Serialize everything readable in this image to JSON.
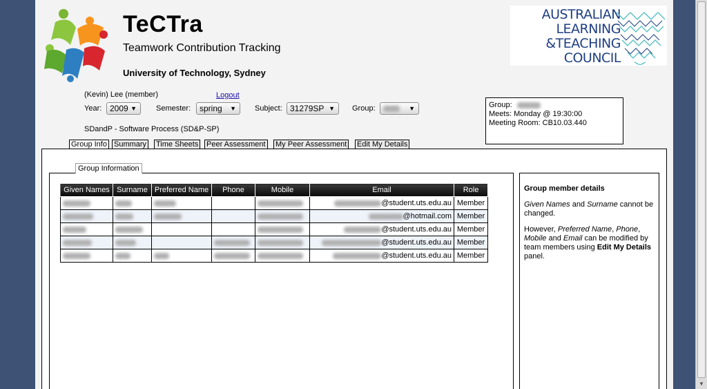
{
  "header": {
    "title": "TeCTra",
    "subtitle": "Teamwork Contribution Tracking",
    "university": "University of Technology, Sydney",
    "partner_logo_lines": [
      "AUSTRALIAN",
      "LEARNING",
      "&TEACHING",
      "COUNCIL"
    ]
  },
  "user": {
    "name": "(Kevin) Lee (member)",
    "logout_label": "Logout"
  },
  "selectors": {
    "year_label": "Year:",
    "year_value": "2009",
    "semester_label": "Semester:",
    "semester_value": "spring",
    "subject_label": "Subject:",
    "subject_value": "31279SP",
    "group_label": "Group:"
  },
  "subject_name": "SDandP - Software Process (SD&P-SP)",
  "group_box": {
    "group_label": "Group:",
    "meets": "Meets: Monday @ 19:30:00",
    "room": "Meeting Room: CB10.03.440"
  },
  "tabs": [
    {
      "label": "Group Info",
      "active": true
    },
    {
      "label": "Summary"
    },
    {
      "label": "Time Sheets"
    },
    {
      "label": "Peer Assessment"
    },
    {
      "label": "My Peer Assessment"
    },
    {
      "label": "Edit My Details"
    }
  ],
  "fieldset_legend": "Group Information",
  "table": {
    "columns": [
      "Given Names",
      "Surname",
      "Preferred Name",
      "Phone",
      "Mobile",
      "Email",
      "Role"
    ],
    "rows": [
      {
        "email": "@student.uts.edu.au",
        "role": "Member"
      },
      {
        "email": "@hotmail.com",
        "role": "Member"
      },
      {
        "email": "@student.uts.edu.au",
        "role": "Member"
      },
      {
        "email": "@student.uts.edu.au",
        "role": "Member"
      },
      {
        "email": "@student.uts.edu.au",
        "role": "Member"
      }
    ]
  },
  "help": {
    "title": "Group member details",
    "p1_a": "Given Names",
    "p1_b": " and ",
    "p1_c": "Surname",
    "p1_d": " cannot be changed.",
    "p2_a": "However, ",
    "p2_b": "Preferred Name",
    "p2_c": ", ",
    "p2_d": "Phone",
    "p2_e": ", ",
    "p2_f": "Mobile",
    "p2_g": " and ",
    "p2_h": "Email",
    "p2_i": " can be modified by team members using ",
    "p2_j": "Edit My Details",
    "p2_k": " panel."
  },
  "colors": {
    "window_bg": "#3e5276",
    "page_bg": "#f3f3f3",
    "table_header": "#1a1a1a",
    "row_alt": "#eef3fa",
    "link": "#1a0dab",
    "partner_logo": "#1f3f82"
  }
}
